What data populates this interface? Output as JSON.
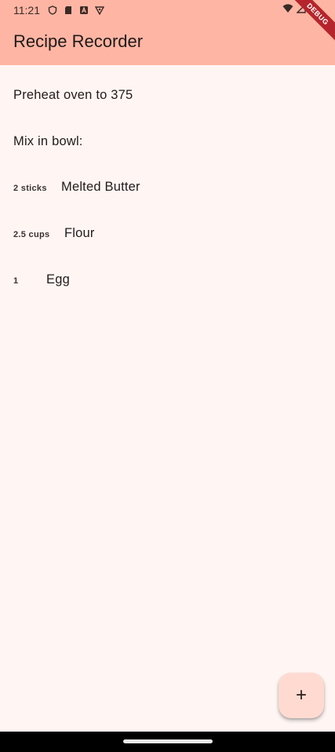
{
  "status_bar": {
    "time": "11:21",
    "left_icons": [
      "shield-icon",
      "sd-card-icon",
      "a-icon",
      "vpn-icon"
    ],
    "right_icons": [
      "wifi-icon",
      "signal-icon",
      "battery-icon"
    ]
  },
  "app": {
    "title": "Recipe Recorder",
    "debug_banner": "DEBUG",
    "header_color": "#ffb5a4",
    "background_color": "#fff6f4"
  },
  "steps": [
    {
      "text": "Preheat oven to 375"
    },
    {
      "text": "Mix in bowl:"
    }
  ],
  "ingredients": [
    {
      "quantity": "2 sticks",
      "name": "Melted Butter"
    },
    {
      "quantity": "2.5 cups",
      "name": "Flour"
    },
    {
      "quantity": "1",
      "name": "Egg"
    }
  ],
  "fab": {
    "label": "+",
    "icon": "plus-icon",
    "color": "#ffdad1"
  }
}
